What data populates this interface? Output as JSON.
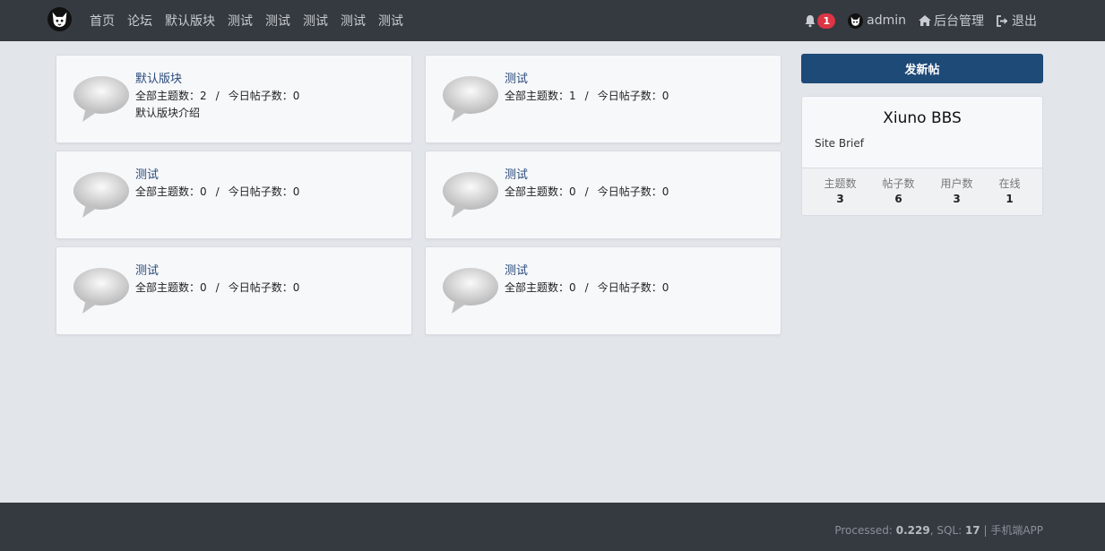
{
  "nav": {
    "links": [
      "首页",
      "论坛",
      "默认版块",
      "测试",
      "测试",
      "测试",
      "测试",
      "测试"
    ],
    "notification_count": "1",
    "username": "admin",
    "admin_label": "后台管理",
    "logout_label": "退出"
  },
  "forums": [
    {
      "title": "默认版块",
      "threads_label": "全部主题数：",
      "threads": "2",
      "sep": "/",
      "today_label": "今日帖子数：",
      "today": "0",
      "desc": "默认版块介绍"
    },
    {
      "title": "测试",
      "threads_label": "全部主题数：",
      "threads": "1",
      "sep": "/",
      "today_label": "今日帖子数：",
      "today": "0",
      "desc": ""
    },
    {
      "title": "测试",
      "threads_label": "全部主题数：",
      "threads": "0",
      "sep": "/",
      "today_label": "今日帖子数：",
      "today": "0",
      "desc": ""
    },
    {
      "title": "测试",
      "threads_label": "全部主题数：",
      "threads": "0",
      "sep": "/",
      "today_label": "今日帖子数：",
      "today": "0",
      "desc": ""
    },
    {
      "title": "测试",
      "threads_label": "全部主题数：",
      "threads": "0",
      "sep": "/",
      "today_label": "今日帖子数：",
      "today": "0",
      "desc": ""
    },
    {
      "title": "测试",
      "threads_label": "全部主题数：",
      "threads": "0",
      "sep": "/",
      "today_label": "今日帖子数：",
      "today": "0",
      "desc": ""
    }
  ],
  "sidebar": {
    "post_button": "发新帖",
    "site_title": "Xiuno BBS",
    "site_brief": "Site Brief",
    "stats": [
      {
        "label": "主题数",
        "value": "3"
      },
      {
        "label": "帖子数",
        "value": "6"
      },
      {
        "label": "用户数",
        "value": "3"
      },
      {
        "label": "在线",
        "value": "1"
      }
    ]
  },
  "footer": {
    "processed_label": "Processed: ",
    "processed_value": "0.229",
    "sql_label": ", SQL: ",
    "sql_value": "17",
    "divider": " | ",
    "app_link": "手机端APP"
  },
  "colors": {
    "navbar": "#343a40",
    "background": "#e2e5ea",
    "primary_button": "#1e4a78",
    "badge": "#dc3545",
    "forum_title": "#2a4a7a"
  }
}
